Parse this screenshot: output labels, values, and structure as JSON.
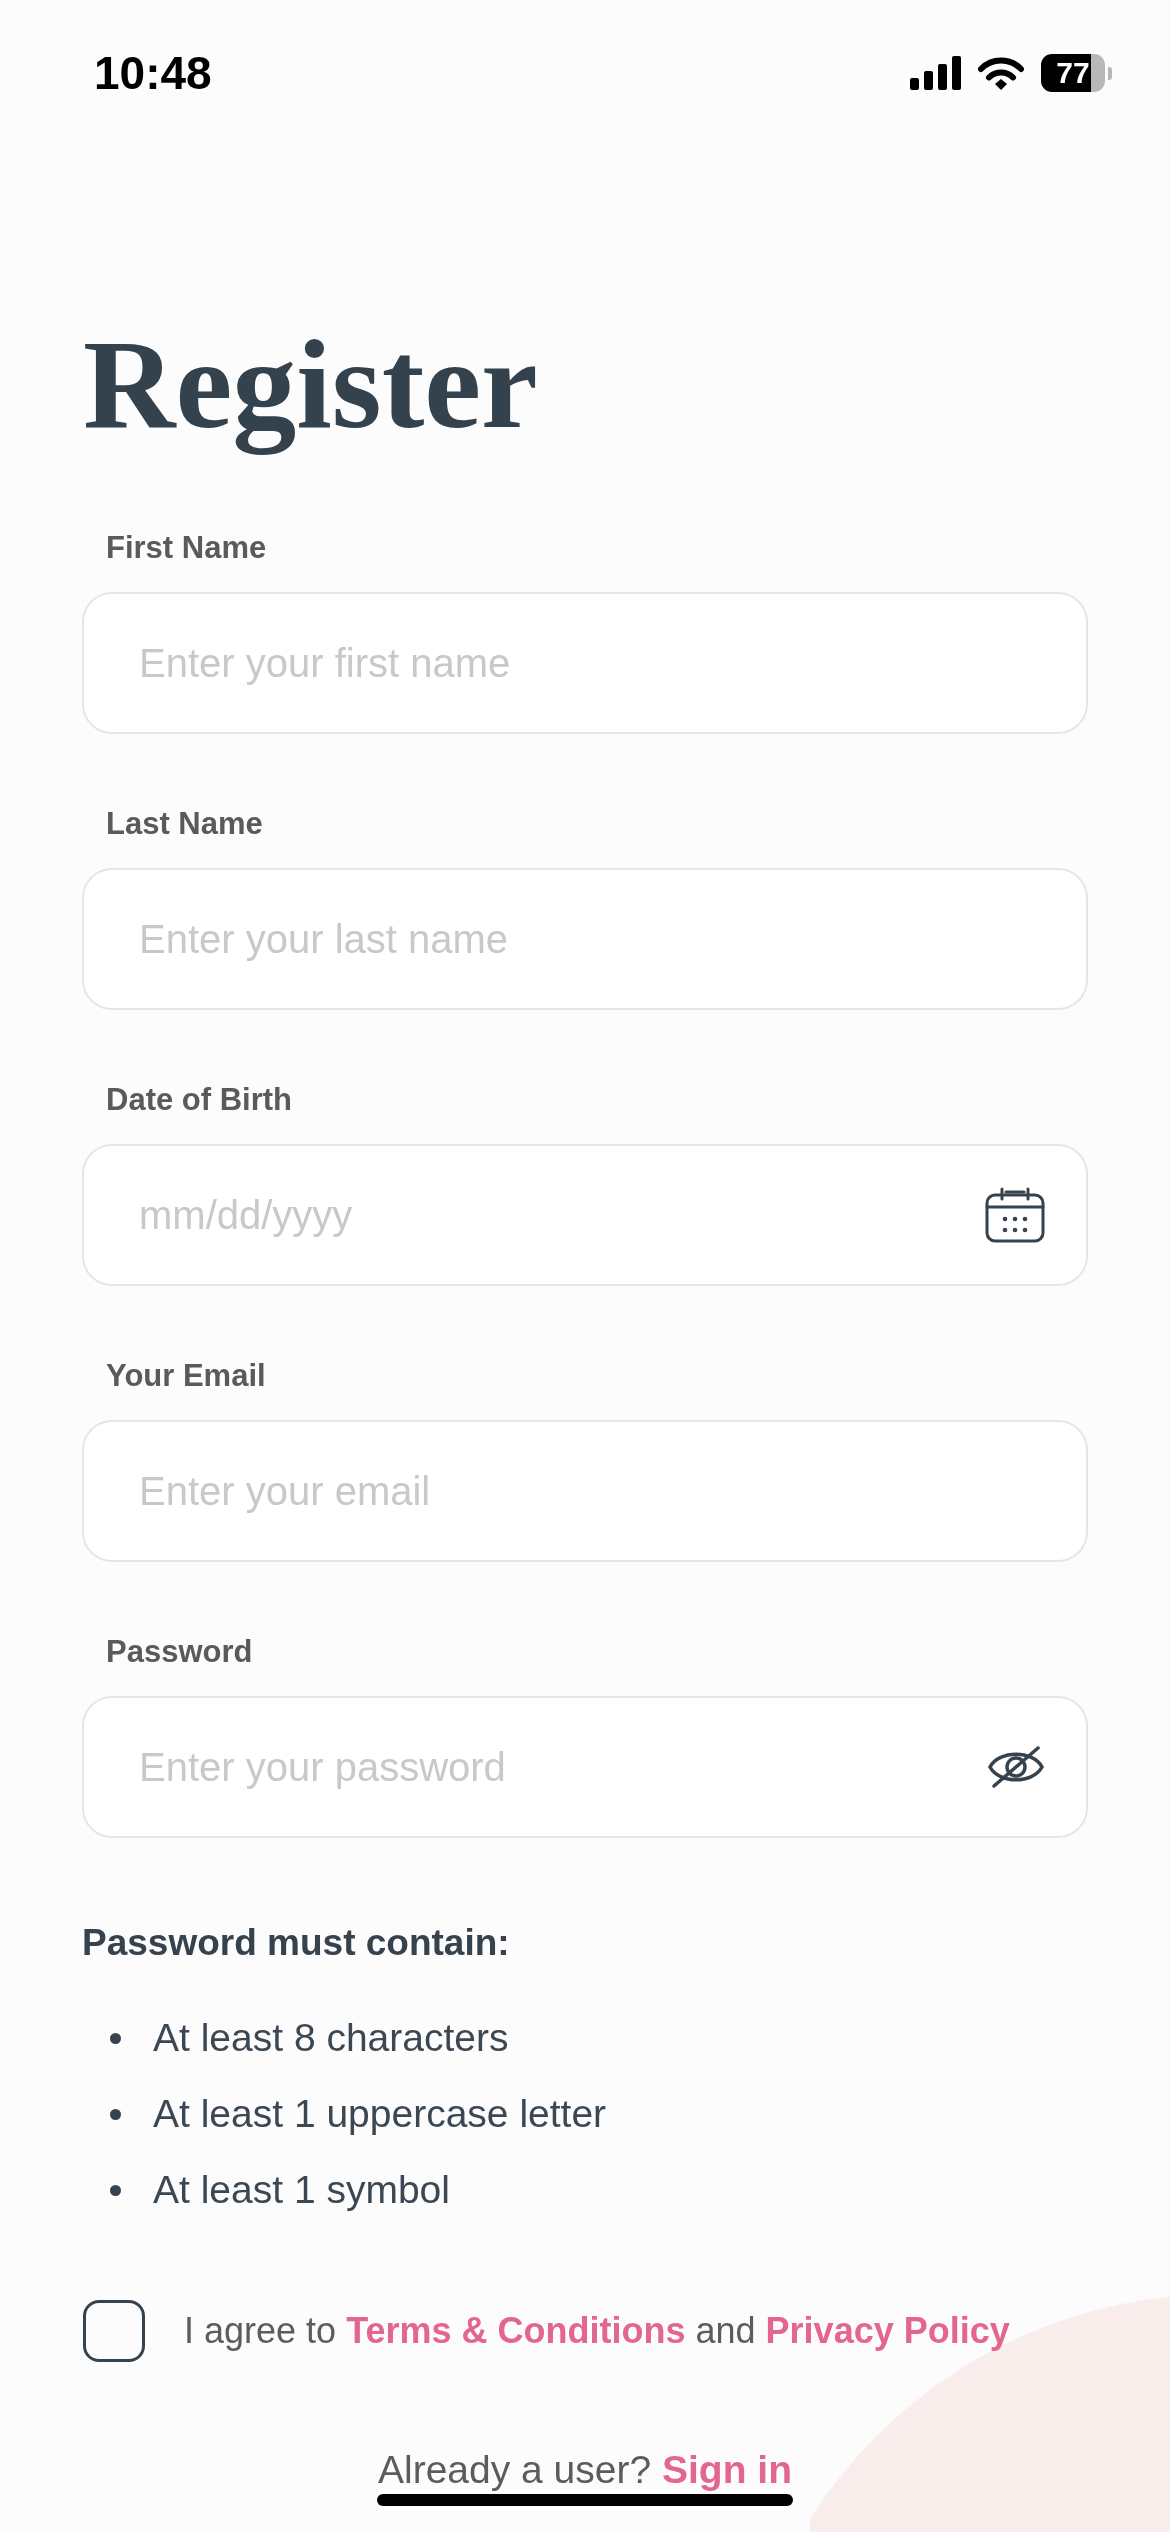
{
  "status_bar": {
    "time": "10:48",
    "battery": "77"
  },
  "title": "Register",
  "fields": [
    {
      "kind": "text",
      "label": "First Name",
      "placeholder": "Enter your first name"
    },
    {
      "kind": "text",
      "label": "Last Name",
      "placeholder": "Enter your last name"
    },
    {
      "kind": "date",
      "label": "Date of Birth",
      "placeholder": "mm/dd/yyyy"
    },
    {
      "kind": "email",
      "label": "Your Email",
      "placeholder": "Enter your email"
    },
    {
      "kind": "password",
      "label": "Password",
      "placeholder": "Enter your password"
    }
  ],
  "password_rules": {
    "heading": "Password must contain:",
    "items": [
      "At least 8 characters",
      "At least 1 uppercase letter",
      "At least 1 symbol"
    ]
  },
  "agreement": {
    "checked": false,
    "parts": [
      {
        "kind": "text",
        "text": "I agree to"
      },
      {
        "kind": "link",
        "text": "Terms & Conditions"
      },
      {
        "kind": "text",
        "text": "and"
      },
      {
        "kind": "link",
        "text": "Privacy Policy"
      }
    ]
  },
  "sign_in": {
    "prompt": "Already a user?",
    "link": "Sign in"
  }
}
